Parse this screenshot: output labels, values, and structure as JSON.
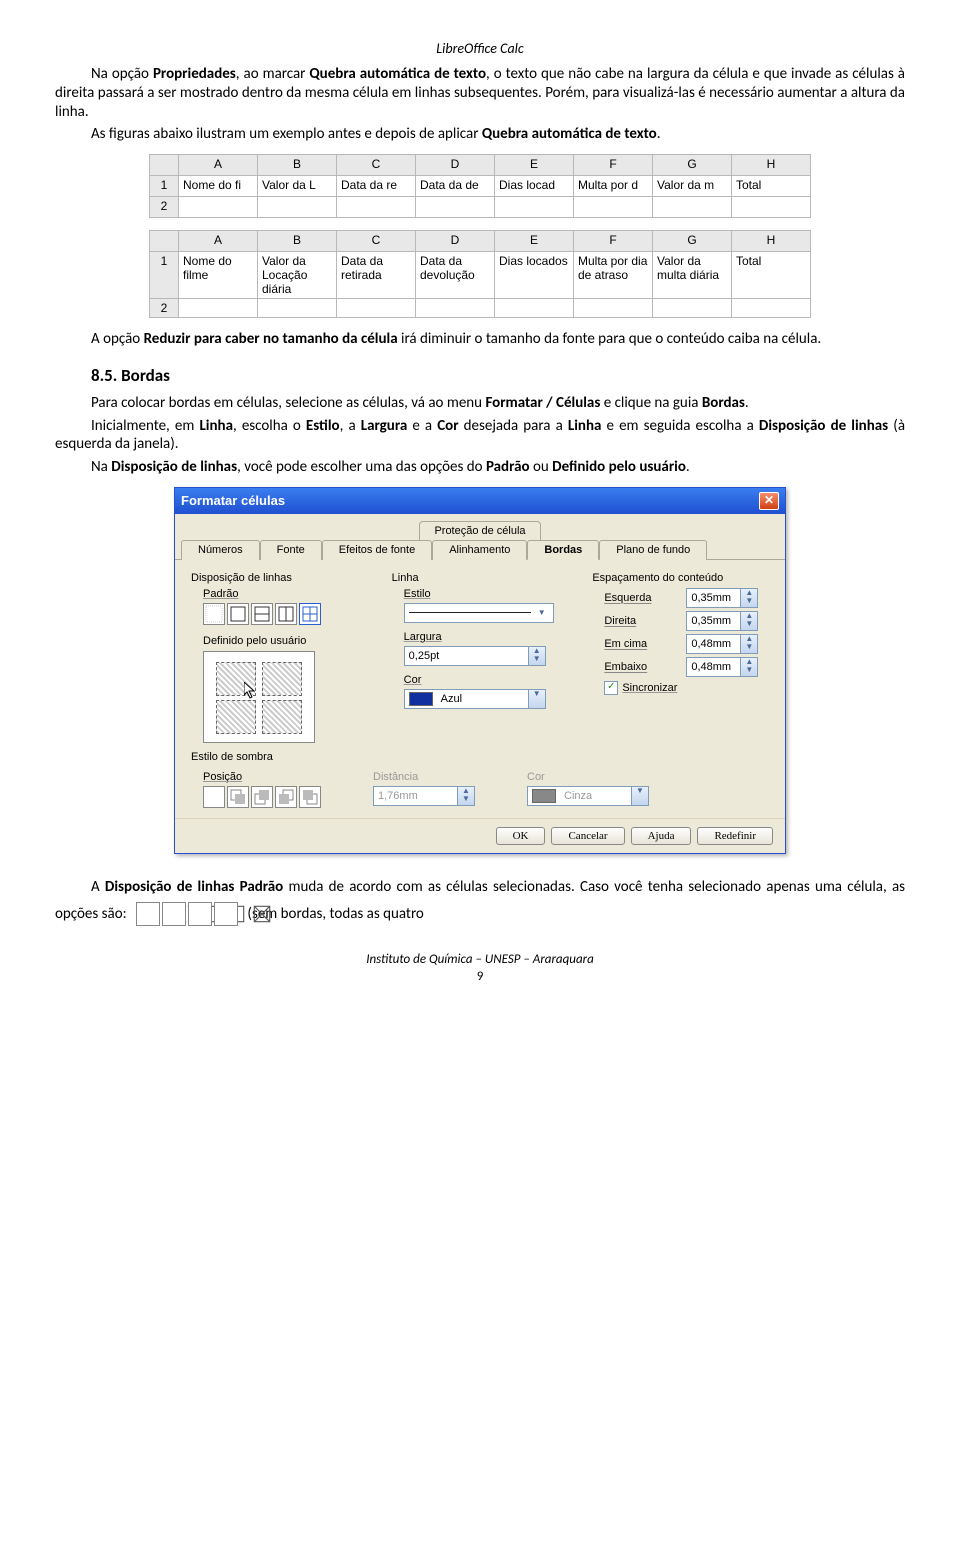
{
  "header": "LibreOffice Calc",
  "p1a": "Na opção ",
  "p1b": "Propriedades",
  "p1c": ", ao marcar ",
  "p1d": "Quebra automática de texto",
  "p1e": ", o texto que não cabe na largura da célula e que invade as células à direita passará a ser mostrado dentro da mesma célula em linhas subsequentes. Porém, para visualizá-las é necessário aumentar a altura da linha.",
  "p2a": "As figuras abaixo ilustram um exemplo antes e depois de aplicar ",
  "p2b": "Quebra automática de texto",
  "p2c": ".",
  "table1": {
    "cols": [
      "A",
      "B",
      "C",
      "D",
      "E",
      "F",
      "G",
      "H"
    ],
    "row1": [
      "Nome do fi",
      "Valor da L",
      "Data da re",
      "Data da de",
      "Dias locad",
      "Multa por d",
      "Valor da m",
      "Total"
    ]
  },
  "table2": {
    "cols": [
      "A",
      "B",
      "C",
      "D",
      "E",
      "F",
      "G",
      "H"
    ],
    "row1": [
      "Nome do filme",
      "Valor da Locação diária",
      "Data da retirada",
      "Data da devolução",
      "Dias locados",
      "Multa por dia de atraso",
      "Valor da multa diária",
      "Total"
    ]
  },
  "p3a": "A opção ",
  "p3b": "Reduzir para caber no tamanho da célula",
  "p3c": " irá diminuir o tamanho da fonte para que o conteúdo caiba na célula.",
  "h_bordas": "8.5. Bordas",
  "p4a": "Para colocar bordas em células, selecione as células, vá ao menu ",
  "p4b": "Formatar / Células",
  "p4c": " e clique na guia ",
  "p4d": "Bordas",
  "p4e": ".",
  "p5a": "Inicialmente, em ",
  "p5b": "Linha",
  "p5c": ", escolha o ",
  "p5d": "Estilo",
  "p5e": ", a ",
  "p5f": "Largura",
  "p5g": " e a ",
  "p5h": "Cor",
  "p5i": " desejada para a ",
  "p5j": "Linha",
  "p5k": " e em seguida escolha a ",
  "p5l": "Disposição de linhas",
  "p5m": " (à esquerda da janela).",
  "p6a": "Na ",
  "p6b": "Disposição de linhas",
  "p6c": ", você pode escolher uma das opções do ",
  "p6d": "Padrão",
  "p6e": " ou ",
  "p6f": "Definido pelo usuário",
  "p6g": ".",
  "dialog": {
    "title": "Formatar células",
    "tab_top": "Proteção de célula",
    "tabs": [
      "Números",
      "Fonte",
      "Efeitos de fonte",
      "Alinhamento",
      "Bordas",
      "Plano de fundo"
    ],
    "disp": "Disposição de linhas",
    "padrao": "Padrão",
    "userdef": "Definido pelo usuário",
    "linha": "Linha",
    "estilo": "Estilo",
    "largura": "Largura",
    "largura_val": "0,25pt",
    "cor": "Cor",
    "cor_val": "Azul",
    "espac": "Espaçamento do conteúdo",
    "esq": "Esquerda",
    "esq_v": "0,35mm",
    "dir": "Direita",
    "dir_v": "0,35mm",
    "cima": "Em cima",
    "cima_v": "0,48mm",
    "baixo": "Embaixo",
    "baixo_v": "0,48mm",
    "sync": "Sincronizar",
    "sombra": "Estilo de sombra",
    "pos": "Posição",
    "dist": "Distância",
    "dist_v": "1,76mm",
    "scor": "Cor",
    "scor_v": "Cinza",
    "btn_ok": "OK",
    "btn_cancel": "Cancelar",
    "btn_help": "Ajuda",
    "btn_reset": "Redefinir"
  },
  "p7a": "A ",
  "p7b": "Disposição de linhas Padrão",
  "p7c": " muda de acordo com as células selecionadas. Caso você tenha selecionado apenas uma célula, as opções são: ",
  "p7d": " (sem bordas, todas as quatro",
  "footer": "Instituto de Química – UNESP – Araraquara",
  "pagenum": "9"
}
